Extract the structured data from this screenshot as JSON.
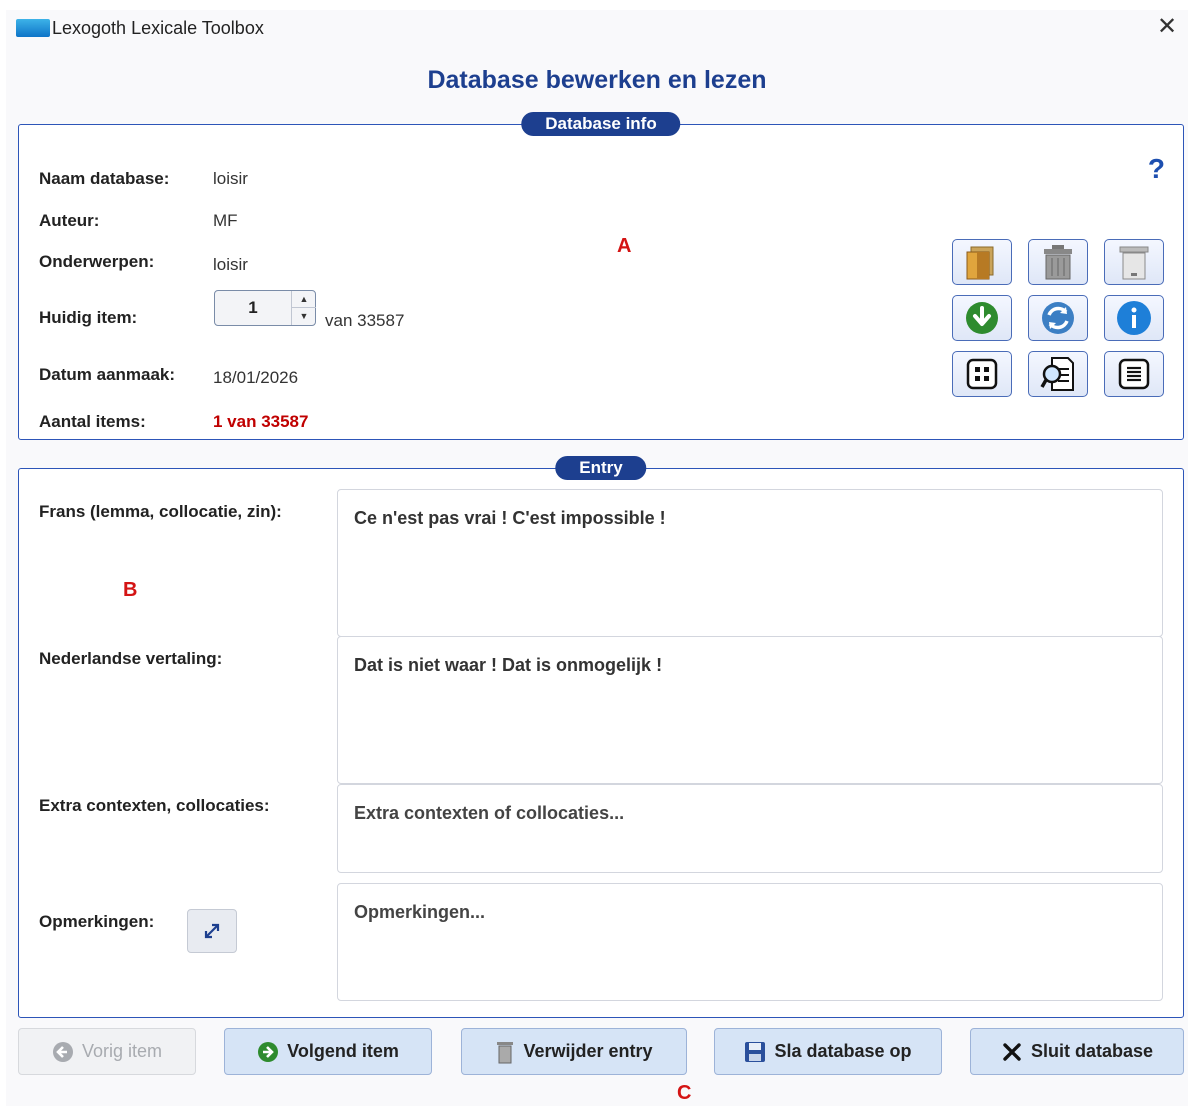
{
  "window": {
    "title": "Lexogoth Lexicale Toolbox"
  },
  "page_title": "Database bewerken en lezen",
  "info": {
    "legend": "Database info",
    "help": "?",
    "name_label": "Naam database:",
    "name_value": "loisir",
    "author_label": "Auteur:",
    "author_value": "MF",
    "subjects_label": "Onderwerpen:",
    "subjects_value": "loisir",
    "current_label": "Huidig item:",
    "current_value": "1",
    "current_total": "van 33587",
    "created_label": "Datum aanmaak:",
    "created_value": "18/01/2026",
    "count_label": "Aantal items:",
    "count_value": "1 van 33587",
    "marker": "A"
  },
  "toolbar": {
    "icons": [
      "open-folder-icon",
      "trash-can-icon",
      "empty-bin-icon",
      "download-icon",
      "refresh-icon",
      "info-icon",
      "grid-icon",
      "search-document-icon",
      "list-icon"
    ]
  },
  "entry": {
    "legend": "Entry",
    "marker": "B",
    "french_label": "Frans (lemma, collocatie, zin):",
    "french_value": "Ce n'est pas vrai ! C'est impossible !",
    "dutch_label": "Nederlandse vertaling:",
    "dutch_value": "Dat is niet waar ! Dat is onmogelijk !",
    "extra_label": "Extra contexten, collocaties:",
    "extra_placeholder": "Extra contexten of collocaties...",
    "remarks_label": "Opmerkingen:",
    "remarks_placeholder": "Opmerkingen..."
  },
  "buttons": {
    "prev": "Vorig item",
    "next": "Volgend item",
    "delete": "Verwijder entry",
    "save": "Sla database op",
    "close": "Sluit database"
  },
  "bottom_marker": "C",
  "colors": {
    "accent": "#1d3f8f",
    "count_red": "#c00000",
    "marker_red": "#d41414"
  }
}
